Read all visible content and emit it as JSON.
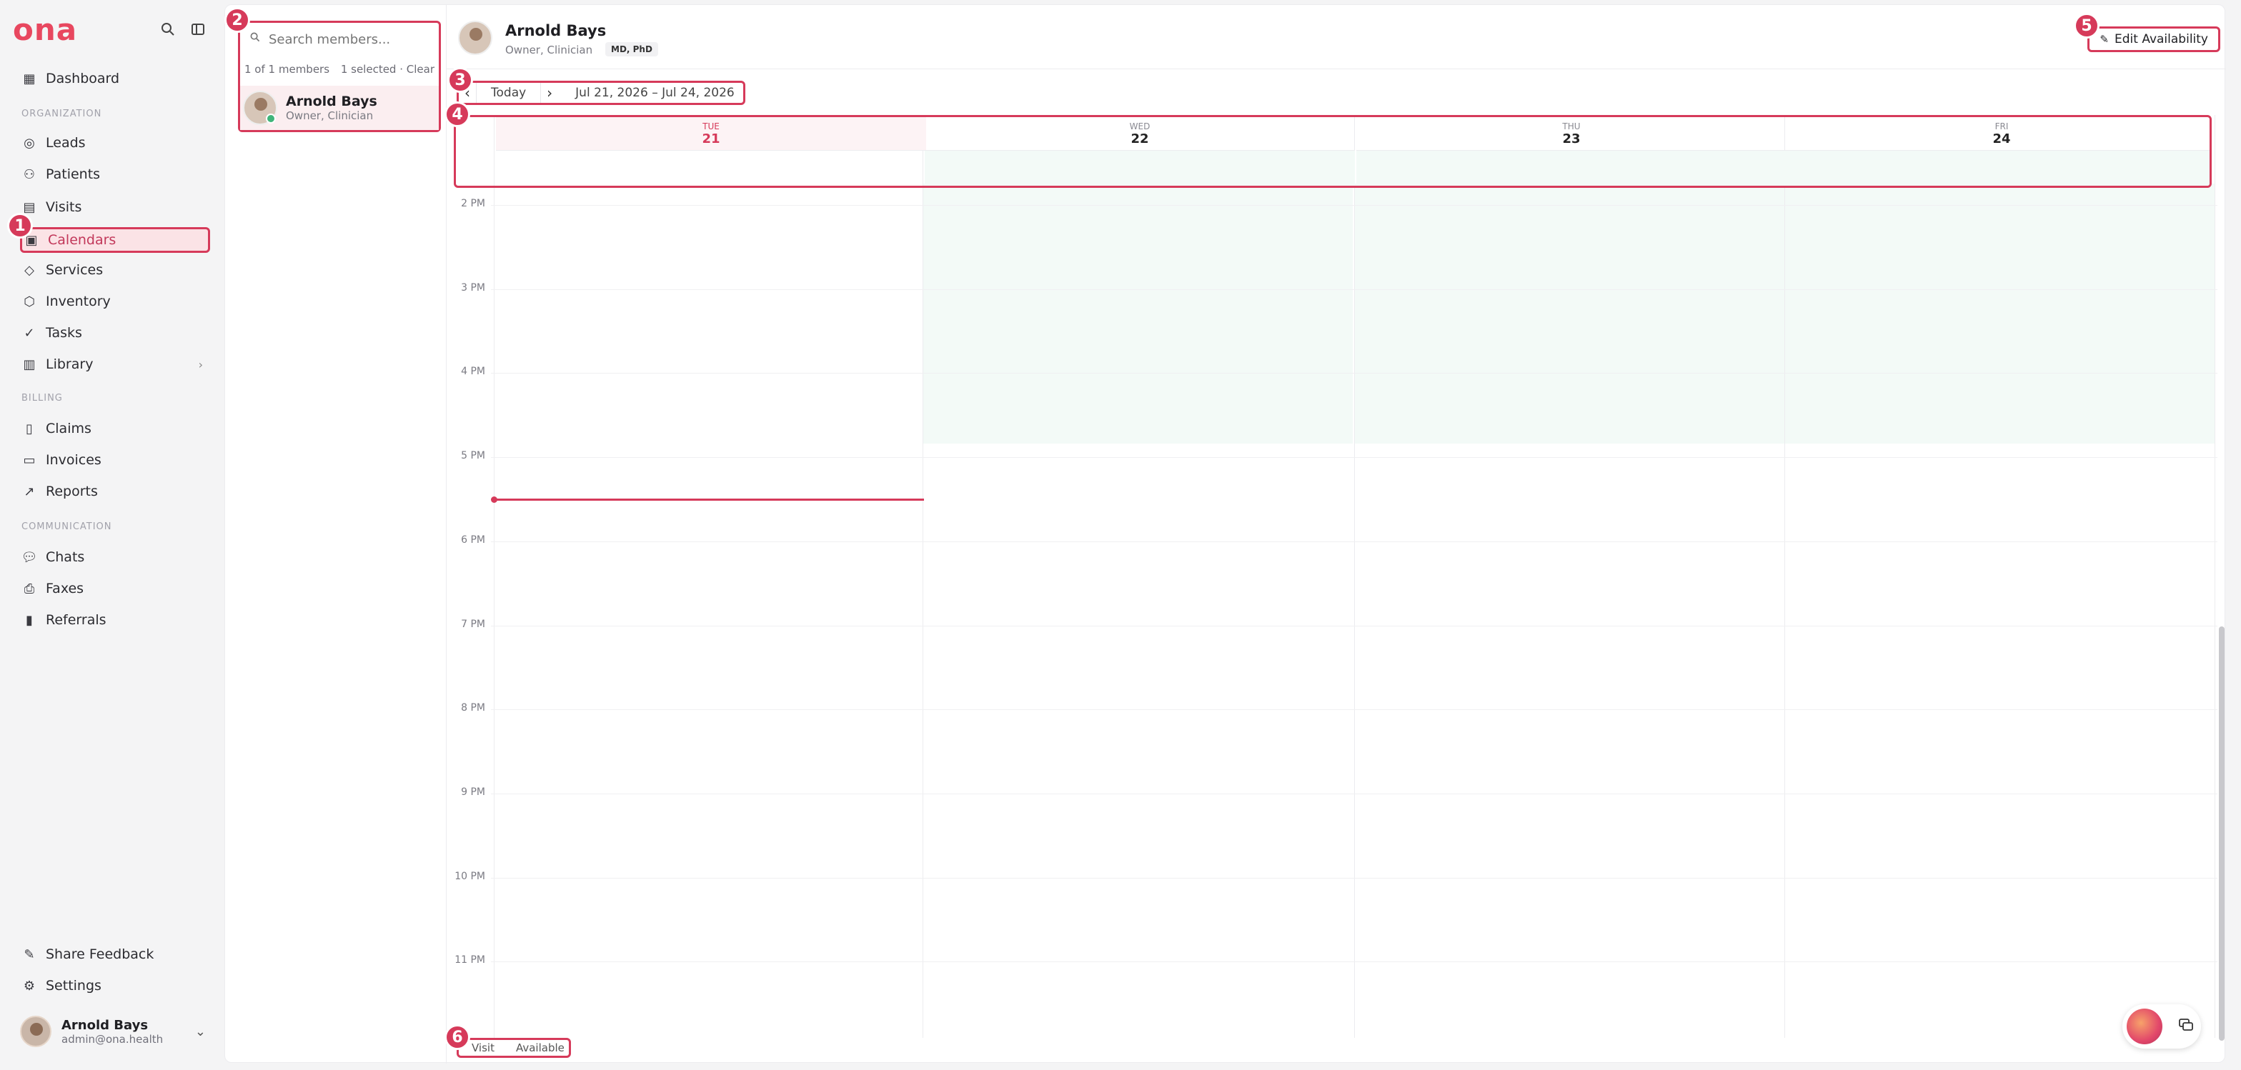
{
  "app": {
    "logo": "ona"
  },
  "sidebar": {
    "items": [
      {
        "label": "Dashboard",
        "icon": "grid-icon"
      },
      {
        "label": "Leads",
        "icon": "target-icon"
      },
      {
        "label": "Patients",
        "icon": "users-icon"
      },
      {
        "label": "Visits",
        "icon": "calendar-icon"
      },
      {
        "label": "Calendars",
        "icon": "calendar-edit-icon"
      },
      {
        "label": "Services",
        "icon": "tag-icon"
      },
      {
        "label": "Inventory",
        "icon": "box-icon"
      },
      {
        "label": "Tasks",
        "icon": "check-circle-icon"
      },
      {
        "label": "Library",
        "icon": "library-icon"
      },
      {
        "label": "Claims",
        "icon": "doc-icon"
      },
      {
        "label": "Invoices",
        "icon": "receipt-icon"
      },
      {
        "label": "Reports",
        "icon": "chart-icon"
      },
      {
        "label": "Chats",
        "icon": "chat-icon"
      },
      {
        "label": "Faxes",
        "icon": "printer-icon"
      },
      {
        "label": "Referrals",
        "icon": "file-icon"
      },
      {
        "label": "Share Feedback",
        "icon": "feedback-icon"
      },
      {
        "label": "Settings",
        "icon": "gear-icon"
      }
    ],
    "sections": {
      "organization": "ORGANIZATION",
      "billing": "BILLING",
      "communication": "COMMUNICATION"
    },
    "user": {
      "name": "Arnold Bays",
      "email": "admin@ona.health"
    }
  },
  "members": {
    "search_placeholder": "Search members...",
    "count": "1 of 1 members",
    "selected": "1 selected · Clear",
    "list": [
      {
        "name": "Arnold Bays",
        "role": "Owner, Clinician"
      }
    ]
  },
  "header": {
    "name": "Arnold Bays",
    "role": "Owner, Clinician",
    "badge": "MD, PhD",
    "edit_label": "Edit Availability"
  },
  "nav": {
    "today": "Today",
    "range": "Jul 21, 2026 – Jul 24, 2026"
  },
  "days": [
    {
      "dow": "TUE",
      "date": "21",
      "today": true
    },
    {
      "dow": "WED",
      "date": "22"
    },
    {
      "dow": "THU",
      "date": "23"
    },
    {
      "dow": "FRI",
      "date": "24"
    }
  ],
  "hours": [
    "2 PM",
    "3 PM",
    "4 PM",
    "5 PM",
    "6 PM",
    "7 PM",
    "8 PM",
    "9 PM",
    "10 PM",
    "11 PM"
  ],
  "legend": {
    "visit": "Visit",
    "available": "Available"
  },
  "markers": [
    "1",
    "2",
    "3",
    "4",
    "5",
    "6"
  ],
  "colors": {
    "accent": "#d63a5a",
    "available": "#f3faf7",
    "today_tint": "#fdf3f5"
  }
}
